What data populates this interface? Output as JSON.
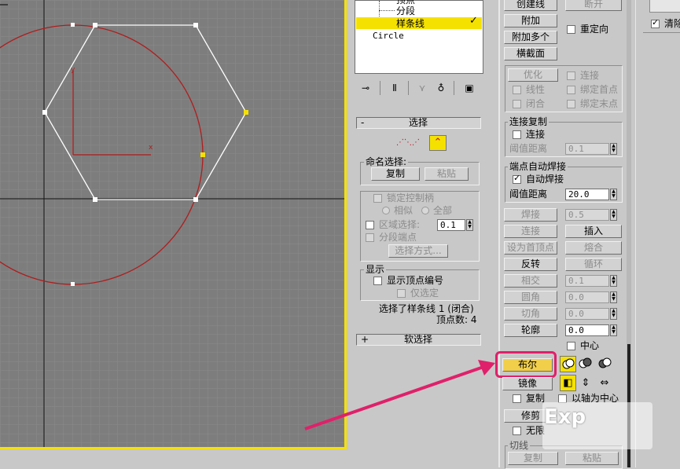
{
  "stack": {
    "items": [
      "顶点",
      "分段",
      "样条线",
      "Circle"
    ]
  },
  "rollout_select": {
    "title": "选择",
    "named_selection_label": "命名选择:",
    "copy_label": "复制",
    "paste_label": "粘贴",
    "lock_handles_label": "锁定控制柄",
    "similar_label": "相似",
    "all_label": "全部",
    "area_select_label": "区域选择:",
    "area_value": "0.1",
    "segment_end_label": "分段端点",
    "select_by_label": "选择方式...",
    "display_label": "显示",
    "show_vertex_numbers_label": "显示顶点编号",
    "selected_only_label": "仅选定",
    "status_line1": "选择了样条线 1 (闭合)",
    "status_line2": "顶点数: 4"
  },
  "rollout_soft": {
    "title": "软选择"
  },
  "geometry": {
    "create_line": "创建线",
    "break": "断开",
    "attach": "附加",
    "attach_multiple": "附加多个",
    "reorient": "重定向",
    "cross_section": "横截面",
    "refine": "优化",
    "connect": "连接",
    "linear": "线性",
    "bind_first": "绑定首点",
    "closed": "闭合",
    "bind_last": "绑定末点",
    "connect_copy_label": "连接复制",
    "connect_copy_check": "连接",
    "threshold_label": "阈值距离",
    "threshold_value": "0.1",
    "end_weld_label": "端点自动焊接",
    "auto_weld": "自动焊接",
    "weld_threshold_label": "阈值距离",
    "weld_threshold_value": "20.0",
    "weld": "焊接",
    "weld_value": "0.5",
    "connect_btn": "连接",
    "insert": "插入",
    "make_first": "设为首顶点",
    "fuse": "熔合",
    "reverse": "反转",
    "cycle": "循环",
    "intersect": "相交",
    "intersect_value": "0.1",
    "fillet": "圆角",
    "fillet_value": "0.0",
    "chamfer": "切角",
    "chamfer_value": "0.0",
    "outline": "轮廓",
    "outline_value": "0.0",
    "center": "中心",
    "boolean": "布尔",
    "mirror": "镜像",
    "copy": "复制",
    "about_pivot": "以轴为中心",
    "trim": "修剪",
    "infinite": "无限",
    "slice_group": "切线",
    "copy_btn": "复制",
    "paste_btn": "粘贴"
  },
  "far_right": {
    "clear_label": "清除"
  },
  "watermark": "Exp",
  "colors": {
    "viewport": "#7d7d7d",
    "grid_line": "#8a8a8a",
    "circle": "#b01d1d",
    "highlight": "#f5e100",
    "arrow": "#e0206a",
    "button_yellow": "#f2cf4a"
  }
}
